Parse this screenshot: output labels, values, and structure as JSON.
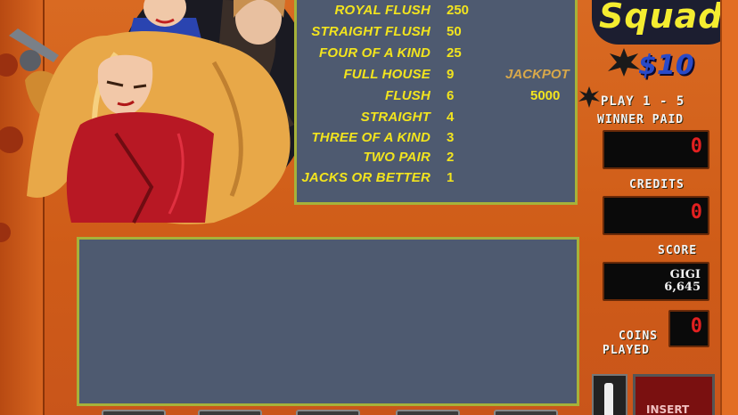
{
  "game": {
    "logo_text": "Squad",
    "bet_price": "$10"
  },
  "paytable": [
    {
      "hand": "ROYAL FLUSH",
      "pay": "250"
    },
    {
      "hand": "STRAIGHT FLUSH",
      "pay": "50"
    },
    {
      "hand": "FOUR OF A KIND",
      "pay": "25"
    },
    {
      "hand": "FULL HOUSE",
      "pay": "9"
    },
    {
      "hand": "FLUSH",
      "pay": "6"
    },
    {
      "hand": "STRAIGHT",
      "pay": "4"
    },
    {
      "hand": "THREE OF A KIND",
      "pay": "3"
    },
    {
      "hand": "TWO PAIR",
      "pay": "2"
    },
    {
      "hand": "JACKS OR BETTER",
      "pay": "1"
    }
  ],
  "jackpot": {
    "label": "JACKPOT",
    "value": "5000"
  },
  "panel": {
    "play_range": "PLAY 1 - 5",
    "winner_paid_label": "WINNER PAID",
    "winner_paid_value": "0",
    "credits_label": "CREDITS",
    "credits_value": "0",
    "score_label": "SCORE",
    "score_name": "GIGI",
    "score_value": "6,645",
    "coins_label": "COINS",
    "played_label": "PLAYED",
    "coins_value": "0",
    "insert_label": "INSERT"
  },
  "colors": {
    "background": "#d4601a",
    "table_bg": "#4e5a70",
    "table_border": "#a6b23a",
    "paytable_text": "#f2e41e",
    "led_text": "#e22020"
  }
}
